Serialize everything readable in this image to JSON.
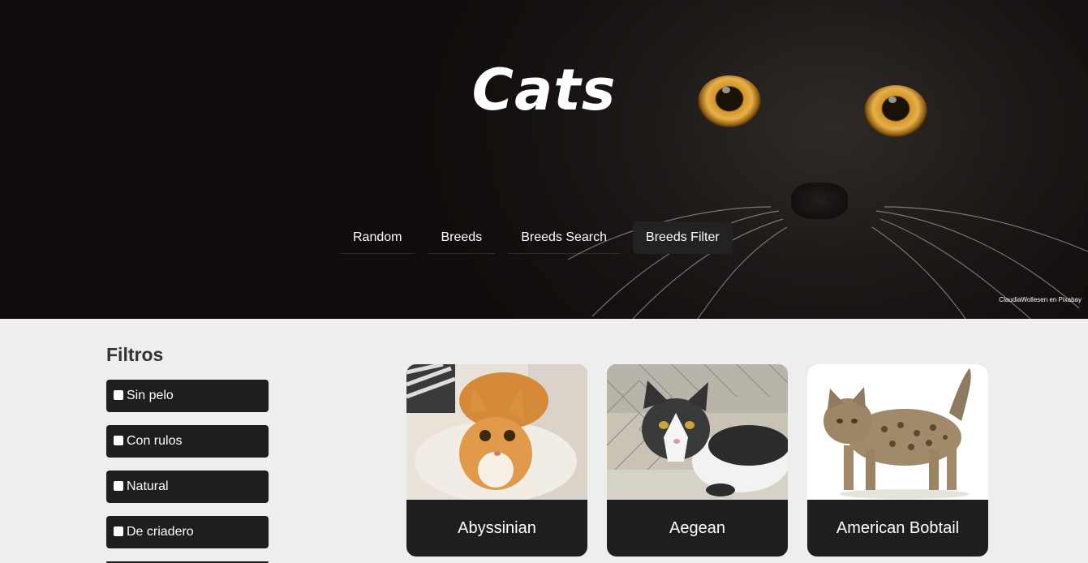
{
  "hero": {
    "title": "Cats",
    "credit": "ClaudiaWollesen en Pixabay",
    "nav": [
      {
        "label": "Random",
        "active": false
      },
      {
        "label": "Breeds",
        "active": false
      },
      {
        "label": "Breeds Search",
        "active": false
      },
      {
        "label": "Breeds Filter",
        "active": true
      }
    ]
  },
  "sidebar": {
    "title": "Filtros",
    "filters": [
      {
        "label": "Sin pelo",
        "checked": false
      },
      {
        "label": "Con rulos",
        "checked": false
      },
      {
        "label": "Natural",
        "checked": false
      },
      {
        "label": "De criadero",
        "checked": false
      }
    ]
  },
  "cards": [
    {
      "name": "Abyssinian",
      "icon": "orange-kitten-photo"
    },
    {
      "name": "Aegean",
      "icon": "black-white-cat-photo"
    },
    {
      "name": "American Bobtail",
      "icon": "tabby-kitten-photo"
    }
  ]
}
